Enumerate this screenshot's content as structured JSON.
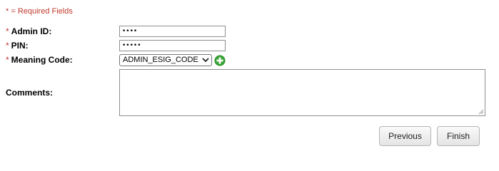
{
  "form": {
    "required_note": "* = Required Fields",
    "required_marker": "*",
    "admin_id": {
      "label": "Admin ID:",
      "value": "••••"
    },
    "pin": {
      "label": "PIN:",
      "value": "•••••"
    },
    "meaning_code": {
      "label": "Meaning Code:",
      "selected": "ADMIN_ESIG_CODE"
    },
    "comments": {
      "label": "Comments:",
      "value": ""
    }
  },
  "buttons": {
    "previous": "Previous",
    "finish": "Finish"
  },
  "colors": {
    "required": "#c0392b",
    "add_icon": "#3aa636"
  },
  "icons": {
    "add": "plus-circle-icon",
    "select": "chevron-down-icon",
    "resize": "resize-grip-icon"
  }
}
